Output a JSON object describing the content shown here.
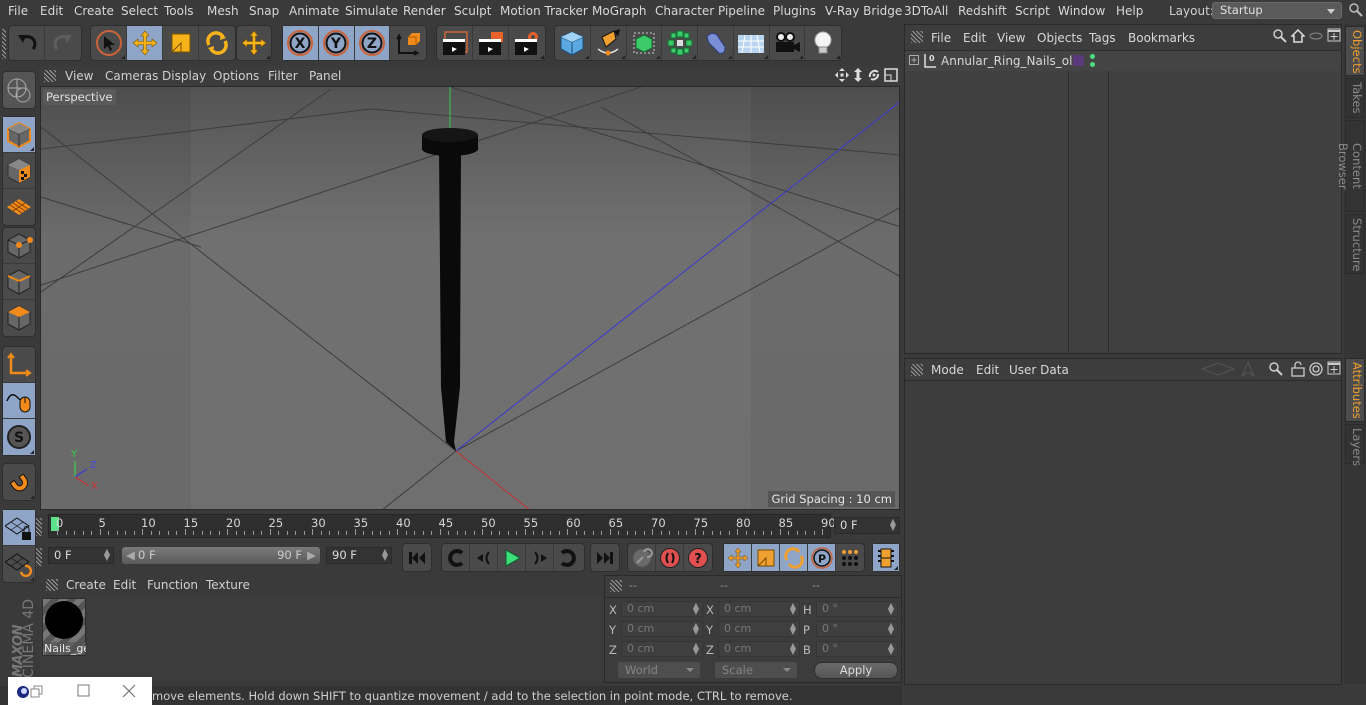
{
  "menubar": {
    "items": [
      "File",
      "Edit",
      "Create",
      "Select",
      "Tools",
      "Mesh",
      "Snap",
      "Animate",
      "Simulate",
      "Render",
      "Sculpt",
      "Motion Tracker",
      "MoGraph",
      "Character",
      "Pipeline",
      "Plugins",
      "V-Ray Bridge",
      "3DToAll",
      "Redshift",
      "Script",
      "Window",
      "Help"
    ],
    "layout_label": "Layout:",
    "layout_value": "Startup"
  },
  "toolbar": {
    "groups": [
      [
        "undo-icon",
        "redo-icon"
      ],
      [
        "select-pointer-icon",
        "move-icon",
        "scale-icon",
        "rotate-icon"
      ],
      [
        "recent-move-icon"
      ],
      [
        "x-axis-lock-icon",
        "y-axis-lock-icon",
        "z-axis-lock-icon",
        "world-coord-icon"
      ],
      [
        "render-view-icon",
        "render-picture-viewer-icon",
        "render-settings-icon"
      ],
      [
        "cube-primitive-icon",
        "pen-spline-icon",
        "subdivision-surface-icon",
        "cloner-icon",
        "deformer-icon",
        "floor-environment-icon",
        "camera-icon",
        "light-icon"
      ]
    ],
    "active": [
      "move-icon",
      "x-axis-lock-icon",
      "y-axis-lock-icon",
      "z-axis-lock-icon"
    ]
  },
  "left_tools": {
    "items": [
      "make-editable-icon",
      "model-mode-icon",
      "texture-mode-icon",
      "workplane-mode-icon",
      "points-mode-icon",
      "edges-mode-icon",
      "polygons-mode-icon",
      "axis-mode-icon",
      "tweak-mode-icon",
      "solo-icon",
      "snap-magnet-icon",
      "locked-workplane-icon",
      "planar-workplane-icon"
    ],
    "logo_brand": "MAXON",
    "logo_product": "CINEMA 4D"
  },
  "viewport": {
    "menu": [
      "View",
      "Cameras",
      "Display",
      "Options",
      "Filter",
      "Panel"
    ],
    "camera_label": "Perspective",
    "grid_spacing": "Grid Spacing : 10 cm",
    "axis_labels": [
      "Y",
      "Z",
      "X"
    ],
    "nav_icons": [
      "pan-icon",
      "dolly-icon",
      "orbit-icon",
      "maximize-view-icon"
    ]
  },
  "timeline": {
    "ticks": [
      "0",
      "5",
      "10",
      "15",
      "20",
      "25",
      "30",
      "35",
      "40",
      "45",
      "50",
      "55",
      "60",
      "65",
      "70",
      "75",
      "80",
      "85",
      "90"
    ],
    "current_frame": "0 F",
    "start_field": "0 F",
    "range_start": "0 F",
    "range_end": "90 F",
    "end_field": "90 F",
    "current_value": 0,
    "min": 0,
    "max": 90
  },
  "playback": {
    "buttons": [
      "go-to-start-icon",
      "prev-keyframe-icon",
      "prev-frame-icon",
      "play-icon",
      "next-frame-icon",
      "next-keyframe-icon",
      "go-to-end-icon"
    ],
    "key_buttons": [
      "motion-record-icon",
      "record-keys-icon",
      "autokey-icon"
    ],
    "track_buttons": [
      "position-track-icon",
      "scale-track-icon",
      "rotation-track-icon",
      "parameter-track-icon",
      "point-level-icon"
    ],
    "timeline_button": "timeline-window-icon"
  },
  "materials": {
    "menu": [
      "Create",
      "Edit",
      "Function",
      "Texture"
    ],
    "items": [
      {
        "name": "Nails_ge",
        "color": "#000000"
      }
    ]
  },
  "coordinates": {
    "headers": [
      "--",
      "--",
      "--"
    ],
    "rows": [
      {
        "label1": "X",
        "pos": "0 cm",
        "label2": "X",
        "size": "0 cm",
        "label3": "H",
        "rot": "0 °"
      },
      {
        "label1": "Y",
        "pos": "0 cm",
        "label2": "Y",
        "size": "0 cm",
        "label3": "P",
        "rot": "0 °"
      },
      {
        "label1": "Z",
        "pos": "0 cm",
        "label2": "Z",
        "size": "0 cm",
        "label3": "B",
        "rot": "0 °"
      }
    ],
    "mode_dropdown": "World",
    "size_dropdown": "Scale",
    "apply_label": "Apply"
  },
  "status": {
    "text": "move elements. Hold down SHIFT to quantize movement / add to the selection in point mode, CTRL to remove."
  },
  "objects_panel": {
    "menu": [
      "File",
      "Edit",
      "View",
      "Objects",
      "Tags",
      "Bookmarks"
    ],
    "objects": [
      {
        "name": "Annular_Ring_Nails_old",
        "tag_color": "#5a3a7a",
        "status_dots": "#4ade80"
      }
    ]
  },
  "attributes_panel": {
    "menu": [
      "Mode",
      "Edit",
      "User Data"
    ]
  },
  "side_tabs": {
    "top": [
      {
        "label": "Objects",
        "active": true
      },
      {
        "label": "Takes",
        "active": false
      },
      {
        "label": "Content Browser",
        "active": false
      },
      {
        "label": "Structure",
        "active": false
      }
    ],
    "bottom": [
      {
        "label": "Attributes",
        "active": true
      },
      {
        "label": "Layers",
        "active": false
      }
    ]
  }
}
